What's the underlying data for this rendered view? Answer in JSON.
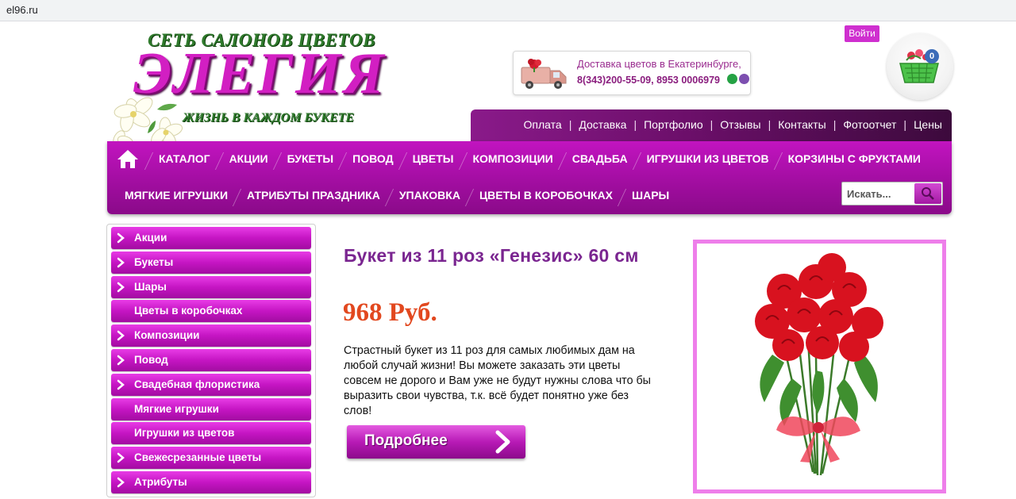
{
  "browser": {
    "url": "el96.ru"
  },
  "header": {
    "logo": {
      "tagline_top": "СЕТЬ САЛОНОВ ЦВЕТОВ",
      "brand": "ЭЛЕГИЯ",
      "tagline_bottom": "ЖИЗНЬ В КАЖДОМ БУКЕТЕ"
    },
    "delivery": {
      "line1": "Доставка цветов в Екатеринбурге,",
      "line2": "8(343)200-55-09, 8953 0006979"
    },
    "login_label": "Войти",
    "cart_count": "0"
  },
  "info_nav": [
    "Оплата",
    "Доставка",
    "Портфолио",
    "Отзывы",
    "Контакты",
    "Фотоотчет",
    "Цены"
  ],
  "main_menu": {
    "row1": [
      "КАТАЛОГ",
      "АКЦИИ",
      "БУКЕТЫ",
      "ПОВОД",
      "ЦВЕТЫ",
      "КОМПОЗИЦИИ",
      "СВАДЬБА",
      "ИГРУШКИ ИЗ ЦВЕТОВ",
      "КОРЗИНЫ С ФРУКТАМИ"
    ],
    "row2": [
      "МЯГКИЕ ИГРУШКИ",
      "АТРИБУТЫ ПРАЗДНИКА",
      "УПАКОВКА",
      "ЦВЕТЫ В КОРОБОЧКАХ",
      "ШАРЫ"
    ]
  },
  "search": {
    "placeholder": "Искать..."
  },
  "sidebar": [
    {
      "label": "Акции",
      "has_arrow": true
    },
    {
      "label": "Букеты",
      "has_arrow": true
    },
    {
      "label": "Шары",
      "has_arrow": true
    },
    {
      "label": "Цветы в коробочках",
      "has_arrow": false
    },
    {
      "label": "Композиции",
      "has_arrow": true
    },
    {
      "label": "Повод",
      "has_arrow": true
    },
    {
      "label": "Свадебная флористика",
      "has_arrow": true
    },
    {
      "label": "Мягкие игрушки",
      "has_arrow": false
    },
    {
      "label": "Игрушки из цветов",
      "has_arrow": false
    },
    {
      "label": "Свежесрезанные цветы",
      "has_arrow": true
    },
    {
      "label": "Атрибуты",
      "has_arrow": true
    }
  ],
  "product": {
    "title": "Букет из 11 роз «Генезис» 60 см",
    "price": "968 Руб.",
    "description": "Страстный букет из 11 роз для самых любимых дам на любой случай жизни! Вы можете заказать эти цветы совсем не дорого и Вам уже не будут нужны слова что бы выразить свои чувства, т.к. всё будет понятно уже без слов!",
    "more_button": "Подробнее"
  },
  "colors": {
    "brand": "#b512b3",
    "accent_price": "#e2481f",
    "title": "#7a2590"
  }
}
